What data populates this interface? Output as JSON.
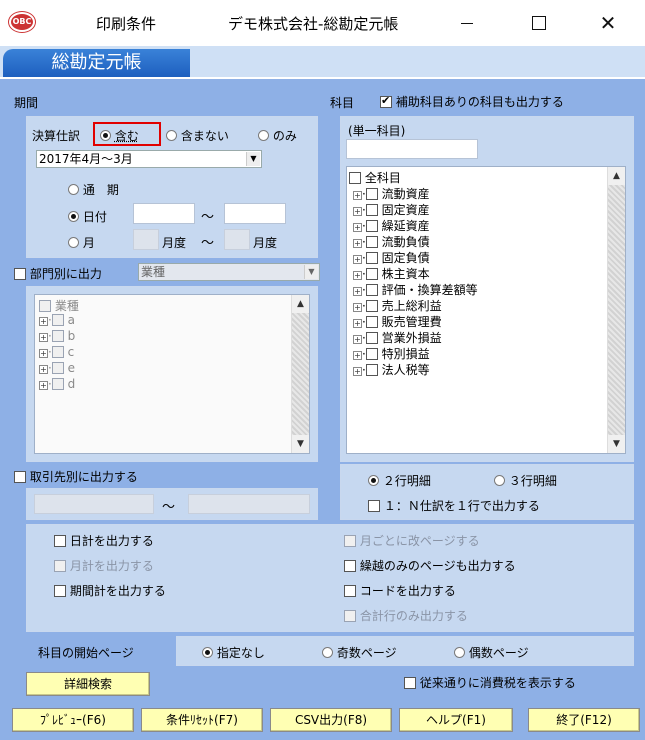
{
  "window": {
    "title_left": "印刷条件",
    "title_right": "デモ株式会社-総勘定元帳",
    "icon_label": "OBC"
  },
  "header": {
    "tab_label": "総勘定元帳"
  },
  "period": {
    "section_label": "期間",
    "settlement_label": "決算仕訳",
    "settlement_options": [
      "含む",
      "含まない",
      "のみ"
    ],
    "settlement_selected": "含む",
    "fiscal_select": "2017年4月～3月",
    "mode_options": [
      "通　期",
      "日付",
      "月"
    ],
    "mode_selected": "日付",
    "date_sep": "～",
    "month_unit_1": "月度",
    "month_sep": "～",
    "month_unit_2": "月度"
  },
  "department": {
    "checkbox_label": "部門別に出力",
    "select_value": "業種",
    "tree_root": "業種",
    "tree_items": [
      "a",
      "b",
      "c",
      "e",
      "d"
    ]
  },
  "account": {
    "section_label": "科目",
    "sub_account_checkbox": "補助科目ありの科目も出力する",
    "single_label": "(単一科目)",
    "tree_root": "全科目",
    "tree_items": [
      "流動資産",
      "固定資産",
      "繰延資産",
      "流動負債",
      "固定負債",
      "株主資本",
      "評価・換算差額等",
      "売上総利益",
      "販売管理費",
      "営業外損益",
      "特別損益",
      "法人税等"
    ]
  },
  "partner": {
    "checkbox_label": "取引先別に出力する",
    "range_sep": "～"
  },
  "detail": {
    "options": [
      "２行明細",
      "３行明細"
    ],
    "selected": "２行明細",
    "one_to_n_checkbox": "１：Ｎ仕訳を１行で出力する"
  },
  "output_options": {
    "daily_total": "日計を出力する",
    "monthly_total": "月計を出力する",
    "period_total": "期間計を出力する",
    "page_break_monthly": "月ごとに改ページする",
    "carry_only_page": "繰越のみのページも出力する",
    "code_output": "コードを出力する",
    "total_row_only": "合計行のみ出力する"
  },
  "start_page": {
    "label": "科目の開始ページ",
    "options": [
      "指定なし",
      "奇数ページ",
      "偶数ページ"
    ],
    "selected": "指定なし"
  },
  "detail_search_button": "詳細検索",
  "tax_checkbox": "従来通りに消費税を表示する",
  "footer_buttons": [
    "ﾌﾟﾚﾋﾞｭｰ(F6)",
    "条件ﾘｾｯﾄ(F7)",
    "CSV出力(F8)",
    "ヘルプ(F1)",
    "終了(F12)"
  ],
  "colors": {
    "client_bg": "#8eb0e6",
    "group_bg": "#c6d8f0",
    "button_bg": "#ffffb3",
    "highlight_box": "#e10000",
    "header_tab": "#2a6fcb"
  }
}
